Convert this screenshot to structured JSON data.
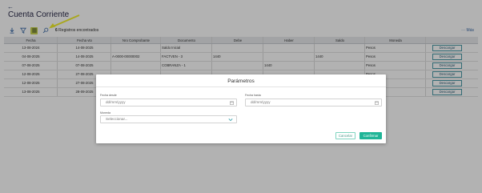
{
  "page": {
    "back_glyph": "←",
    "title": "Cuenta Corriente"
  },
  "toolbar": {
    "icons": [
      "download-icon",
      "filter-icon",
      "columns-icon",
      "search-icon"
    ],
    "records_count": "6",
    "records_label": "Registros encontrados",
    "more_label": "··· Más"
  },
  "table": {
    "columns": [
      "Fecha",
      "Fecha vto",
      "Nro Comprobante",
      "Documento",
      "Debe",
      "Haber",
      "Saldo",
      "Moneda",
      ""
    ],
    "rows": [
      [
        "13-08-2024",
        "14-08-2025",
        "",
        "Saldo Inicial",
        "",
        "",
        "",
        "Pesos",
        "Descargar"
      ],
      [
        "04-08-2025",
        "14-08-2025",
        "A-0000-00000002",
        "FACTVEN - 3",
        "1440",
        "",
        "1440",
        "Pesos",
        "Descargar"
      ],
      [
        "07-08-2025",
        "07-08-2025",
        "",
        "COBRANZA - 1",
        "",
        "1440",
        "",
        "Pesos",
        "Descargar"
      ],
      [
        "12-08-2025",
        "27-08-2025",
        "",
        "",
        "",
        "",
        "",
        "Pesos",
        "Descargar"
      ],
      [
        "12-08-2025",
        "27-08-2025",
        "",
        "",
        "",
        "",
        "",
        "Pesos",
        "Descargar"
      ],
      [
        "13-08-2025",
        "28-09-2025",
        "",
        "",
        "",
        "",
        "",
        "Pesos",
        "Descargar"
      ]
    ]
  },
  "modal": {
    "title": "Parámetros",
    "fecha_desde_label": "Fecha desde",
    "fecha_desde_placeholder": "dd/mm/yyyy",
    "fecha_hasta_label": "Fecha hasta",
    "fecha_hasta_placeholder": "dd/mm/yyyy",
    "moneda_label": "Moneda",
    "moneda_value": "Seleccionar...",
    "cancel_label": "Cancelar",
    "confirm_label": "Confirmar"
  },
  "colors": {
    "accent": "#1fb597",
    "annotation_arrow": "#f2f02a",
    "active_icon_bg": "#c8d34e"
  }
}
